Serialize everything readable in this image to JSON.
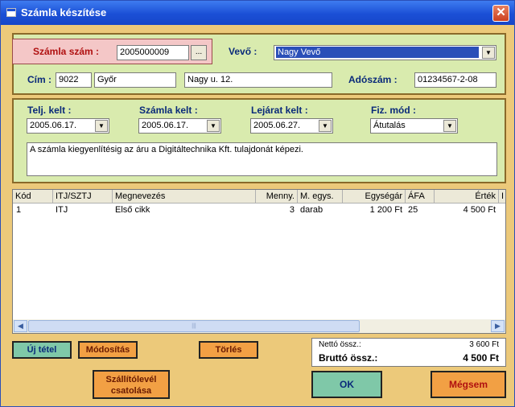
{
  "window": {
    "title": "Számla készítése",
    "close": "✕"
  },
  "header": {
    "invoice_no_label": "Számla szám :",
    "invoice_no_value": "2005000009",
    "ellipsis": "...",
    "buyer_label": "Vevő :",
    "buyer_value": "Nagy Vevő",
    "address_label": "Cím :",
    "zip": "9022",
    "city": "Győr",
    "street": "Nagy u. 12.",
    "tax_label": "Adószám :",
    "tax_value": "01234567-2-08"
  },
  "dates": {
    "telj_label": "Telj. kelt :",
    "telj_value": "2005.06.17.",
    "szamla_label": "Számla kelt :",
    "szamla_value": "2005.06.17.",
    "lejarat_label": "Lejárat kelt :",
    "lejarat_value": "2005.06.27.",
    "fizmod_label": "Fiz. mód :",
    "fizmod_value": "Átutalás",
    "note": "A számla kiegyenlítésig az áru a Digitáltechnika Kft. tulajdonát képezi."
  },
  "table": {
    "headers": [
      "Kód",
      "ITJ/SZTJ",
      "Megnevezés",
      "Menny.",
      "M. egys.",
      "Egységár",
      "ÁFA",
      "Érték",
      "I"
    ],
    "rows": [
      [
        "1",
        "ITJ",
        "Első cikk",
        "3",
        "darab",
        "1 200 Ft",
        "25",
        "4 500 Ft",
        ""
      ]
    ]
  },
  "buttons": {
    "new_item": "Új tétel",
    "modify": "Módosítás",
    "delete": "Törlés",
    "attach_line1": "Szállítólevél",
    "attach_line2": "csatolása",
    "ok": "OK",
    "cancel": "Mégsem"
  },
  "totals": {
    "net_label": "Nettó össz.:",
    "net_value": "3 600 Ft",
    "gross_label": "Bruttó össz.:",
    "gross_value": "4 500 Ft"
  },
  "colors": {
    "window_bg": "#ECC97A",
    "panel_bg": "#D9EBAE",
    "titlebar": "#1b4fd6",
    "selection": "#2a4fb8"
  }
}
